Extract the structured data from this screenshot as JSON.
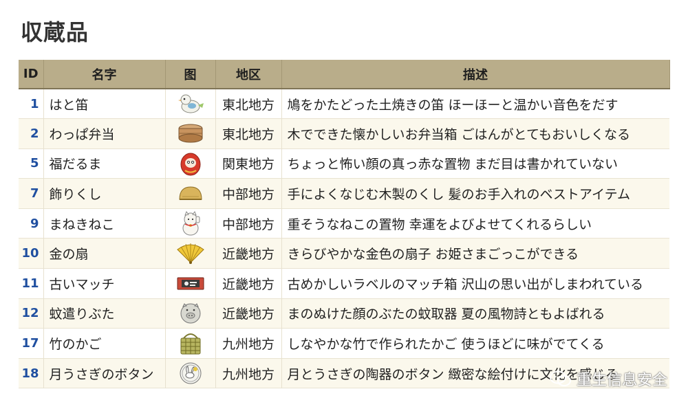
{
  "title": "収蔵品",
  "headers": {
    "id": "ID",
    "name": "名字",
    "img": "图",
    "region": "地区",
    "desc": "描述"
  },
  "rows": [
    {
      "id": "1",
      "name": "はと笛",
      "icon": "pigeon-whistle-icon",
      "region": "東北地方",
      "desc": "鳩をかたどった土焼きの笛 ほーほーと温かい音色をだす"
    },
    {
      "id": "2",
      "name": "わっぱ弁当",
      "icon": "wooden-lunchbox-icon",
      "region": "東北地方",
      "desc": "木でできた懐かしいお弁当箱 ごはんがとてもおいしくなる"
    },
    {
      "id": "5",
      "name": "福だるま",
      "icon": "daruma-icon",
      "region": "関東地方",
      "desc": "ちょっと怖い顔の真っ赤な置物 まだ目は書かれていない"
    },
    {
      "id": "7",
      "name": "飾りくし",
      "icon": "comb-icon",
      "region": "中部地方",
      "desc": "手によくなじむ木製のくし 髪のお手入れのベストアイテム"
    },
    {
      "id": "9",
      "name": "まねきねこ",
      "icon": "beckoning-cat-icon",
      "region": "中部地方",
      "desc": "重そうなねこの置物 幸運をよびよせてくれるらしい"
    },
    {
      "id": "10",
      "name": "金の扇",
      "icon": "golden-fan-icon",
      "region": "近畿地方",
      "desc": "きらびやかな金色の扇子 お姫さまごっこができる"
    },
    {
      "id": "11",
      "name": "古いマッチ",
      "icon": "matchbox-icon",
      "region": "近畿地方",
      "desc": "古めかしいラベルのマッチ箱 沢山の思い出がしまわれている"
    },
    {
      "id": "12",
      "name": "蚊遣りぶた",
      "icon": "mosquito-pig-icon",
      "region": "近畿地方",
      "desc": "まのぬけた顔のぶたの蚊取器 夏の風物詩ともよばれる"
    },
    {
      "id": "17",
      "name": "竹のかご",
      "icon": "bamboo-basket-icon",
      "region": "九州地方",
      "desc": "しなやかな竹で作られたかご 使うほどに味がでてくる"
    },
    {
      "id": "18",
      "name": "月うさぎのボタン",
      "icon": "rabbit-button-icon",
      "region": "九州地方",
      "desc": "月とうさぎの陶器のボタン 緻密な絵付けに文化を感じる"
    }
  ],
  "watermark": "重生信息安全",
  "colors": {
    "header_bg": "#b9ad8a",
    "id_text": "#1f4fa0",
    "row_alt": "#fbf8ec"
  }
}
